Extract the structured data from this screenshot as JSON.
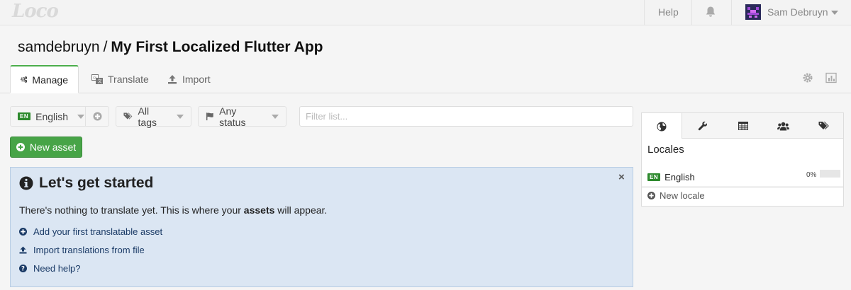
{
  "topbar": {
    "logo": "Loco",
    "help_label": "Help",
    "user_name": "Sam Debruyn",
    "icons": [
      "bell-icon",
      "avatar",
      "chevron-down-icon"
    ]
  },
  "breadcrumb": {
    "owner": "samdebruyn",
    "separator": "/",
    "project": "My First Localized Flutter App"
  },
  "tabs": [
    {
      "label": "Manage",
      "icon": "gears-icon",
      "active": true
    },
    {
      "label": "Translate",
      "icon": "translate-icon",
      "active": false
    },
    {
      "label": "Import",
      "icon": "upload-icon",
      "active": false
    }
  ],
  "tab_right_icons": [
    "gear-icon",
    "bar-chart-icon"
  ],
  "filters": {
    "locale_badge": "EN",
    "locale_label": "English",
    "tags_label": "All tags",
    "status_label": "Any status",
    "search_placeholder": "Filter list..."
  },
  "new_asset_label": "New asset",
  "info_panel": {
    "title": "Let's get started",
    "text_before": "There's nothing to translate yet. This is where your ",
    "text_bold": "assets",
    "text_after": " will appear.",
    "close_symbol": "×",
    "links": [
      {
        "label": "Add your first translatable asset",
        "icon": "plus-circle-icon"
      },
      {
        "label": "Import translations from file",
        "icon": "upload-icon"
      },
      {
        "label": "Need help?",
        "icon": "question-circle-icon"
      }
    ]
  },
  "side_panel": {
    "tab_icons": [
      "globe-icon",
      "wrench-icon",
      "table-icon",
      "users-icon",
      "tags-icon"
    ],
    "title": "Locales",
    "locale": {
      "badge": "EN",
      "name": "English",
      "progress_text": "0%",
      "progress": 0
    },
    "new_locale_label": "New locale"
  },
  "colors": {
    "accent_green": "#47a447",
    "info_background": "#dbe6f3",
    "link_blue": "#1a3a66"
  }
}
